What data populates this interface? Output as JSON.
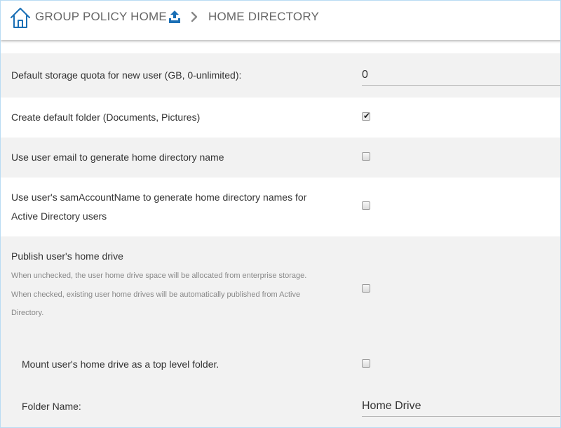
{
  "breadcrumb": {
    "home_label": "GROUP POLICY HOME",
    "current_label": "HOME DIRECTORY"
  },
  "settings": {
    "storage_quota": {
      "label": "Default storage quota for new user (GB, 0-unlimited):",
      "value": "0"
    },
    "create_default_folder": {
      "label": "Create default folder (Documents, Pictures)",
      "checked": true
    },
    "use_email": {
      "label": "Use user email to generate home directory name",
      "checked": false
    },
    "use_sam": {
      "label_line1": "Use user's samAccountName to generate home directory names for",
      "label_line2": "Active Directory users",
      "checked": false
    },
    "publish_home": {
      "label": "Publish user's home drive",
      "desc_line1": "When unchecked, the user home drive space will be allocated from enterprise storage.",
      "desc_line2": "When checked, existing user home drives will be automatically published from Active",
      "desc_line3": "Directory.",
      "checked": false
    },
    "mount_top_level": {
      "label": "Mount user's home drive as a top level folder.",
      "checked": false
    },
    "folder_name": {
      "label": "Folder Name:",
      "value": "Home Drive"
    }
  },
  "colors": {
    "accent": "#1a6fb5",
    "row_grey": "#f2f2f2",
    "frame_border": "#b9dcf3"
  }
}
